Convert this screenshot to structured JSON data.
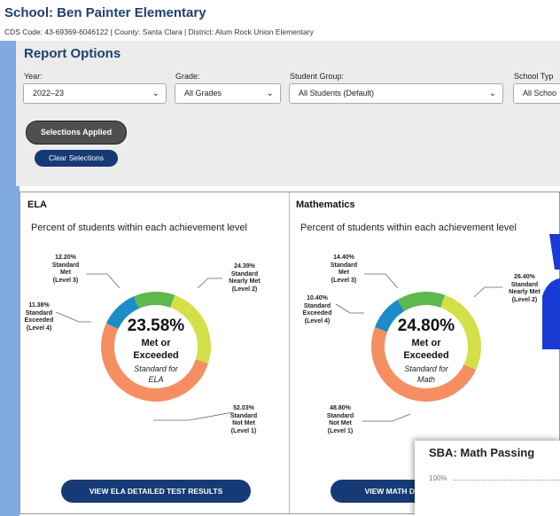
{
  "header": {
    "school": "School: Ben Painter Elementary",
    "sub": "CDS Code: 43-69369-6046122  |  County: Santa Clara  |  District: Alum Rock Union Elementary"
  },
  "options": {
    "title": "Report Options",
    "year_label": "Year:",
    "year_value": "2022–23",
    "grade_label": "Grade:",
    "grade_value": "All Grades",
    "group_label": "Student Group:",
    "group_value": "All Students (Default)",
    "type_label": "School Typ",
    "type_value": "All Schoo",
    "applied": "Selections Applied",
    "clear": "Clear Selections"
  },
  "ela": {
    "title": "ELA",
    "desc": "Percent of students within each achievement level",
    "pct": "23.58%",
    "met1": "Met or",
    "met2": "Exceeded",
    "std1": "Standard for",
    "std2": "ELA",
    "l3": [
      "12.20%",
      "Standard",
      "Met",
      "(Level 3)"
    ],
    "l2": [
      "24.39%",
      "Standard",
      "Nearly Met",
      "(Level 2)"
    ],
    "l4": [
      "11.38%",
      "Standard",
      "Exceeded",
      "(Level 4)"
    ],
    "l1": [
      "52.03%",
      "Standard",
      "Not Met",
      "(Level 1)"
    ],
    "button": "VIEW ELA DETAILED TEST RESULTS",
    "levels": [
      12.2,
      24.39,
      52.03,
      11.38
    ]
  },
  "math": {
    "title": "Mathematics",
    "desc": "Percent of students within each achievement level",
    "pct": "24.80%",
    "met1": "Met or",
    "met2": "Exceeded",
    "std1": "Standard for",
    "std2": "Math",
    "l3": [
      "14.40%",
      "Standard",
      "Met",
      "(Level 3)"
    ],
    "l2": [
      "26.40%",
      "Standard",
      "Nearly Met",
      "(Level 2)"
    ],
    "l4": [
      "10.40%",
      "Standard",
      "Exceeded",
      "(Level 4)"
    ],
    "l1": [
      "48.80%",
      "Standard",
      "Not Met",
      "(Level 1)"
    ],
    "button": "VIEW MATH DETA",
    "levels": [
      14.4,
      26.4,
      48.8,
      10.4
    ]
  },
  "overlay": {
    "title": "SBA: Math Passing",
    "pct": "100%"
  },
  "colors": {
    "level3": "#5db84e",
    "level2": "#d4e04a",
    "level1": "#f58f62",
    "level4": "#1b8cc7",
    "navy": "#163a75"
  }
}
